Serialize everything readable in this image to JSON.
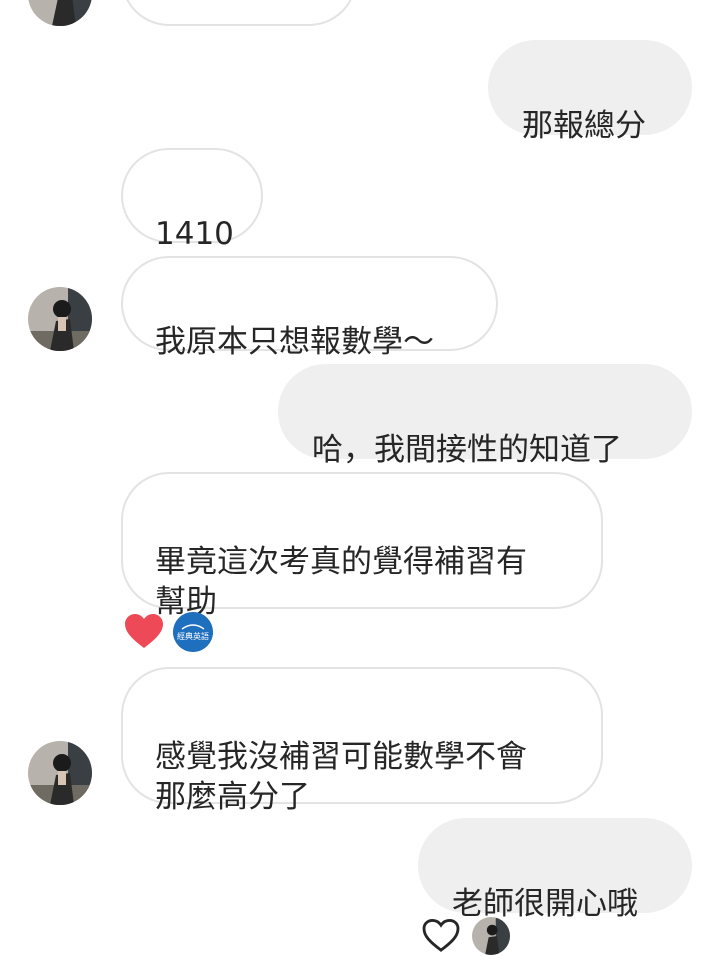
{
  "messages": [
    {
      "id": "m0",
      "direction": "incoming",
      "text": ""
    },
    {
      "id": "m1",
      "direction": "outgoing",
      "text": "那報總分"
    },
    {
      "id": "m2",
      "direction": "incoming",
      "text": "1410"
    },
    {
      "id": "m3",
      "direction": "incoming",
      "text": "我原本只想報數學～"
    },
    {
      "id": "m4",
      "direction": "outgoing",
      "text": "哈，我間接性的知道了"
    },
    {
      "id": "m5",
      "direction": "incoming",
      "text": "畢竟這次考真的覺得補習有\n幫助"
    },
    {
      "id": "m6",
      "direction": "incoming",
      "text": "感覺我沒補習可能數學不會\n那麼高分了"
    },
    {
      "id": "m7",
      "direction": "outgoing",
      "text": "老師很開心哦"
    }
  ],
  "reactions": {
    "m5": {
      "icon": "heart-filled-icon",
      "reactor_badge_text": "經典英語",
      "color": "#ed4956",
      "badge_color": "#1f6fbf"
    },
    "m7": {
      "icon": "heart-outline-icon",
      "color": "#262626"
    }
  },
  "colors": {
    "incoming_border": "#e3e3e3",
    "outgoing_bg": "#efefef",
    "text": "#262626"
  }
}
